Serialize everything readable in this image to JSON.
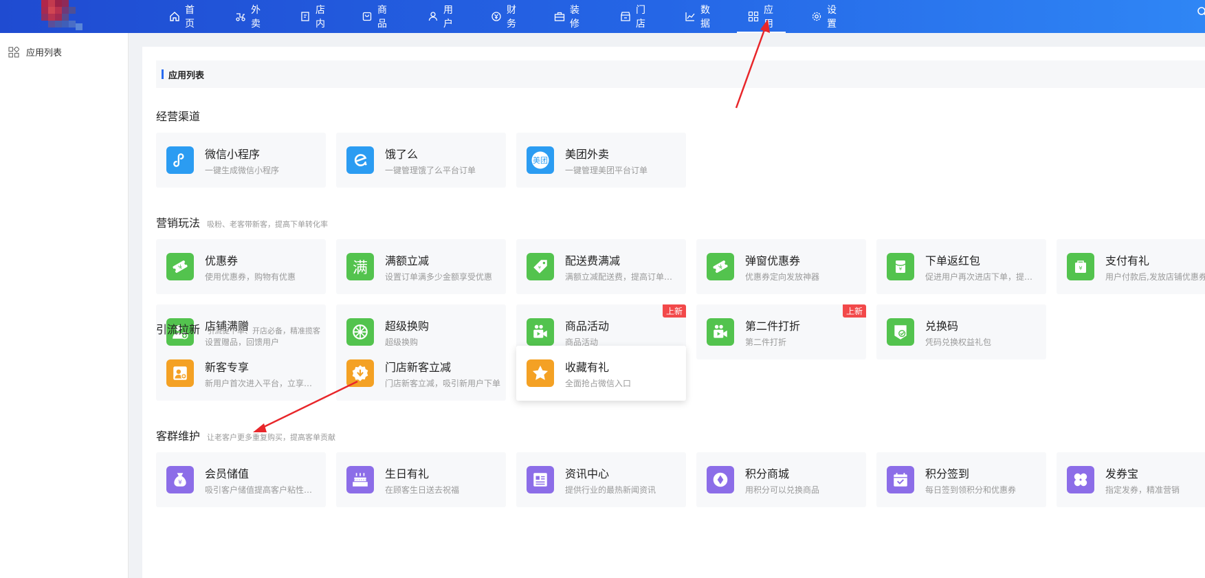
{
  "nav": [
    {
      "label": "首页",
      "icon": "home-icon"
    },
    {
      "label": "外卖",
      "icon": "scooter-icon"
    },
    {
      "label": "店内",
      "icon": "document-icon"
    },
    {
      "label": "商品",
      "icon": "shopping-bag-icon"
    },
    {
      "label": "用户",
      "icon": "user-icon"
    },
    {
      "label": "财务",
      "icon": "wallet-icon"
    },
    {
      "label": "装修",
      "icon": "toolbox-icon"
    },
    {
      "label": "门店",
      "icon": "store-icon"
    },
    {
      "label": "数据",
      "icon": "chart-icon"
    },
    {
      "label": "应用",
      "icon": "apps-icon",
      "active": true
    },
    {
      "label": "设置",
      "icon": "gear-icon"
    }
  ],
  "sidebar": {
    "items": [
      {
        "label": "应用列表",
        "icon": "apps-icon"
      }
    ]
  },
  "main": {
    "title": "应用列表",
    "sections": [
      {
        "title": "经营渠道",
        "subtitle": "",
        "cards": [
          {
            "name": "微信小程序",
            "desc": "一键生成微信小程序",
            "color": "blue",
            "icon": "mini-program-icon"
          },
          {
            "name": "饿了么",
            "desc": "一键管理饿了么平台订单",
            "color": "blue",
            "icon": "eleme-icon"
          },
          {
            "name": "美团外卖",
            "desc": "一键管理美团平台订单",
            "color": "blue",
            "icon": "meituan-icon",
            "icon_text": "美团"
          }
        ]
      },
      {
        "title": "营销玩法",
        "subtitle": "吸粉、老客带新客，提高下单转化率",
        "cards": [
          {
            "name": "优惠券",
            "desc": "使用优惠券，购物有优惠",
            "color": "green",
            "icon": "coupon-icon"
          },
          {
            "name": "满额立减",
            "desc": "设置订单满多少金额享受优惠",
            "color": "green",
            "icon": "full-reduction-icon",
            "icon_text": "满"
          },
          {
            "name": "配送费满减",
            "desc": "满额立减配送费，提高订单转化率",
            "color": "green",
            "icon": "price-tag-icon"
          },
          {
            "name": "弹窗优惠券",
            "desc": "优惠券定向发放神器",
            "color": "green",
            "icon": "coupon-icon"
          },
          {
            "name": "下单返红包",
            "desc": "促进用户再次进店下单，提高复购率",
            "color": "green",
            "icon": "red-packet-icon"
          },
          {
            "name": "支付有礼",
            "desc": "用户付款后,发放店铺优惠券",
            "color": "green",
            "icon": "gift-bag-icon"
          },
          {
            "name": "店铺满赠",
            "desc": "设置赠品，回馈用户",
            "color": "green",
            "icon": "user-gift-icon"
          },
          {
            "name": "超级换购",
            "desc": "超级换购",
            "color": "green",
            "icon": "wheel-icon"
          },
          {
            "name": "商品活动",
            "desc": "商品活动",
            "color": "green",
            "icon": "video-camera-icon",
            "badge": "上新"
          },
          {
            "name": "第二件打折",
            "desc": "第二件打折",
            "color": "green",
            "icon": "video-camera-icon",
            "badge": "上新"
          },
          {
            "name": "兑换码",
            "desc": "凭码兑换权益礼包",
            "color": "green",
            "icon": "redeem-code-icon"
          }
        ]
      },
      {
        "title": "引流拉新",
        "subtitle": "引流促下单、开店必备，精准揽客",
        "cards": [
          {
            "name": "新客专享",
            "desc": "新用户首次进入平台，立享新客优惠",
            "color": "orange",
            "icon": "new-customer-icon"
          },
          {
            "name": "门店新客立减",
            "desc": "门店新客立减，吸引新用户下单",
            "color": "orange",
            "icon": "discount-badge-icon"
          },
          {
            "name": "收藏有礼",
            "desc": "全面抢占微信入口",
            "color": "orange",
            "icon": "star-icon",
            "raised": true
          }
        ]
      },
      {
        "title": "客群维护",
        "subtitle": "让老客户更多重复购买，提高客单贡献",
        "cards": [
          {
            "name": "会员储值",
            "desc": "吸引客户储值提高客户粘性和忠诚度",
            "color": "purple",
            "icon": "money-bag-icon"
          },
          {
            "name": "生日有礼",
            "desc": "在顾客生日送去祝福",
            "color": "purple",
            "icon": "cake-icon"
          },
          {
            "name": "资讯中心",
            "desc": "提供行业的最热新闻资讯",
            "color": "purple",
            "icon": "news-icon"
          },
          {
            "name": "积分商城",
            "desc": "用积分可以兑换商品",
            "color": "purple",
            "icon": "points-icon"
          },
          {
            "name": "积分签到",
            "desc": "每日签到领积分和优惠券",
            "color": "purple",
            "icon": "calendar-check-icon"
          },
          {
            "name": "发券宝",
            "desc": "指定发券，精准营销",
            "color": "purple",
            "icon": "clover-icon"
          }
        ]
      }
    ]
  },
  "colors": {
    "accent": "#2a6cf0",
    "blue": "#2b9cf2",
    "green": "#53c34e",
    "orange": "#f4a124",
    "purple": "#8c6de8",
    "badge": "#f2494a",
    "arrow": "#e8262a"
  }
}
